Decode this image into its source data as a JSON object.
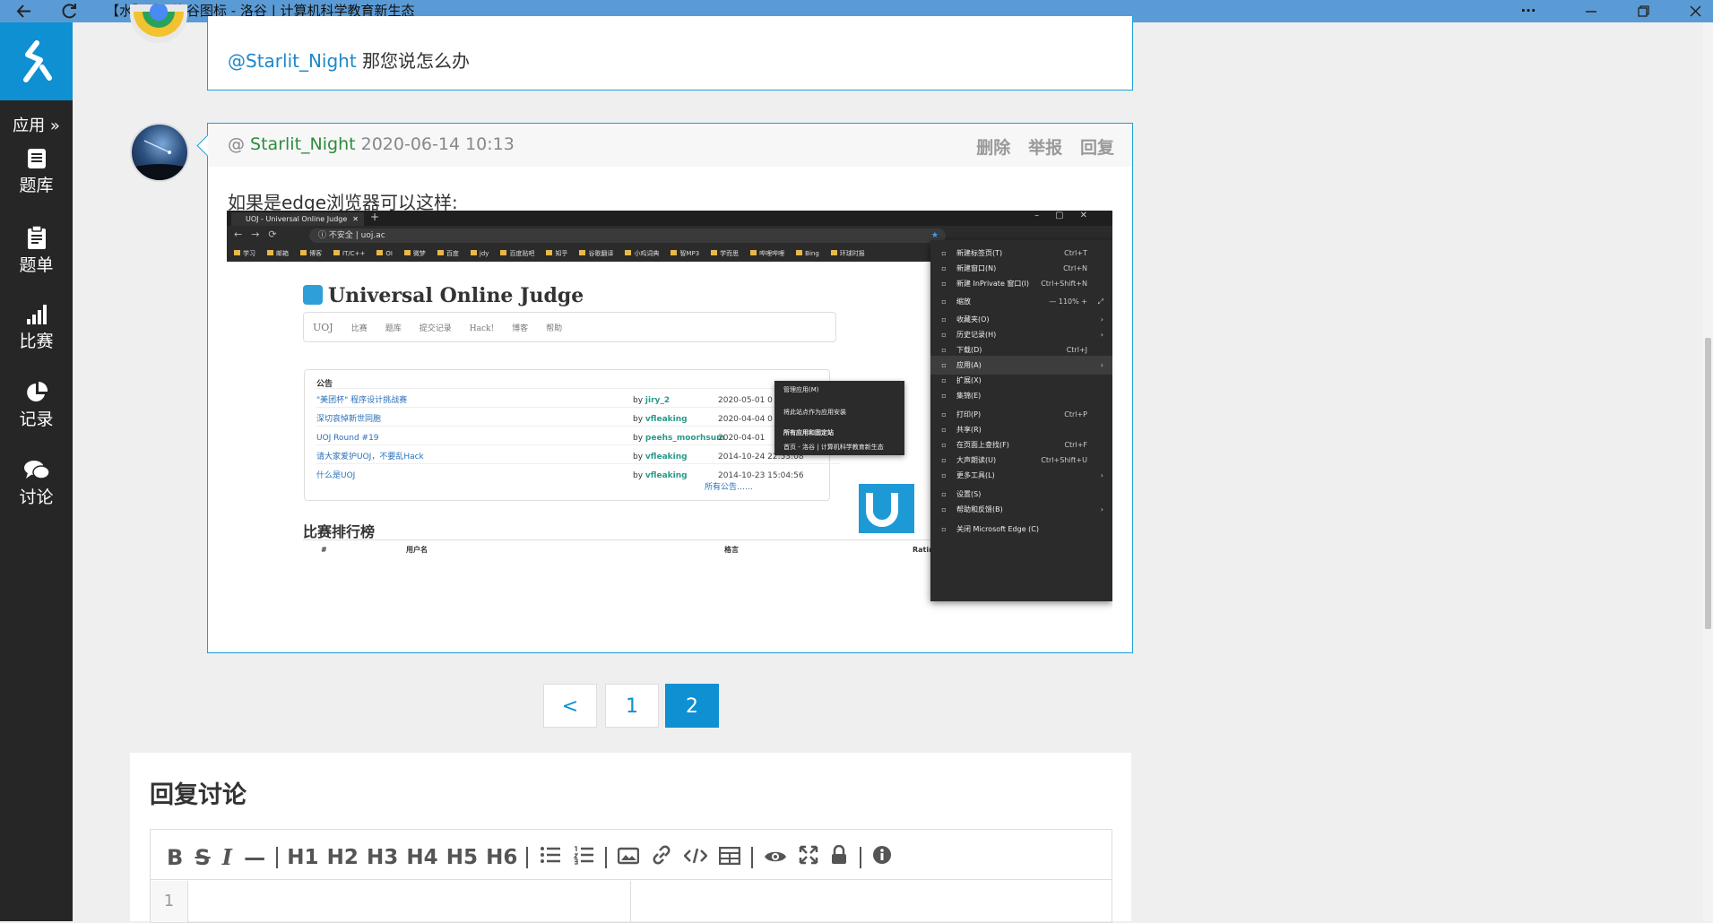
{
  "window": {
    "title": "【水】关于洛谷图标 - 洛谷 | 计算机科学教育新生态",
    "more_label": "···"
  },
  "sidebar": {
    "toggle_label": "应用 »",
    "items": [
      {
        "label": "题库",
        "icon": "book-icon"
      },
      {
        "label": "题单",
        "icon": "clipboard-icon"
      },
      {
        "label": "比赛",
        "icon": "bar-chart-icon"
      },
      {
        "label": "记录",
        "icon": "pie-chart-icon"
      },
      {
        "label": "讨论",
        "icon": "chat-icon"
      }
    ]
  },
  "reply_prev": {
    "mention": "@Starlit_Night",
    "text": "那您说怎么办"
  },
  "reply_main": {
    "at": "@",
    "author": "Starlit_Night",
    "time": "2020-06-14 10:13",
    "actions": {
      "delete": "删除",
      "report": "举报",
      "reply": "回复"
    },
    "text": "如果是edge浏览器可以这样:"
  },
  "embedded_screenshot": {
    "tab_title": "UOJ - Universal Online Judge",
    "address_warning": "不安全",
    "address": "uoj.ac",
    "bookmarks": [
      "学习",
      "邮箱",
      "博客",
      "IT/C++",
      "OI",
      "微梦",
      "百度",
      "jdy",
      "百度贴吧",
      "知乎",
      "谷歌翻译",
      "小鸡词典",
      "智MP3",
      "学而思",
      "哔哩哔哩",
      "Bing",
      "环球时报"
    ],
    "site_title": "Universal Online Judge",
    "site_nav": [
      "UOJ",
      "比赛",
      "题库",
      "提交记录",
      "Hack!",
      "博客",
      "帮助"
    ],
    "announce_heading": "公告",
    "announcements": [
      {
        "title": "\"美团杯\" 程序设计挑战赛",
        "by": "by",
        "author": "jiry_2",
        "date": "2020-05-01 0"
      },
      {
        "title": "深切哀悼新世同胞",
        "by": "by",
        "author": "vfleaking",
        "date": "2020-04-04 0"
      },
      {
        "title": "UOJ Round #19",
        "by": "by",
        "author": "peehs_moorhsum",
        "date": "2020-04-01"
      },
      {
        "title": "请大家爱护UOJ，不要乱Hack",
        "by": "by",
        "author": "vfleaking",
        "date": "2014-10-24 22:53:08"
      },
      {
        "title": "什么是UOJ",
        "by": "by",
        "author": "vfleaking",
        "date": "2014-10-23 15:04:56"
      }
    ],
    "all_announcements": "所有公告……",
    "rank_heading": "比赛排行榜",
    "rank_columns": [
      "#",
      "用户名",
      "格言",
      "Rating"
    ],
    "apps_submenu": [
      "管理应用(M)",
      "将此站点作为应用安装",
      "所有应用和固定站",
      "首页 - 洛谷 | 计算机科学教育新生态"
    ],
    "edge_menu": [
      {
        "label": "新建标签页(T)",
        "shortcut": "Ctrl+T",
        "arrow": ""
      },
      {
        "label": "新建窗口(N)",
        "shortcut": "Ctrl+N",
        "arrow": ""
      },
      {
        "label": "新建 InPrivate 窗口(I)",
        "shortcut": "Ctrl+Shift+N",
        "arrow": ""
      },
      {
        "label": "缩放",
        "shortcut": "—   110%   +",
        "arrow": "⤢"
      },
      {
        "label": "收藏夹(O)",
        "shortcut": "",
        "arrow": "›"
      },
      {
        "label": "历史记录(H)",
        "shortcut": "",
        "arrow": "›"
      },
      {
        "label": "下载(D)",
        "shortcut": "Ctrl+J",
        "arrow": ""
      },
      {
        "label": "应用(A)",
        "shortcut": "",
        "arrow": "›"
      },
      {
        "label": "扩展(X)",
        "shortcut": "",
        "arrow": ""
      },
      {
        "label": "集锦(E)",
        "shortcut": "",
        "arrow": ""
      },
      {
        "label": "打印(P)",
        "shortcut": "Ctrl+P",
        "arrow": ""
      },
      {
        "label": "共享(R)",
        "shortcut": "",
        "arrow": ""
      },
      {
        "label": "在页面上查找(F)",
        "shortcut": "Ctrl+F",
        "arrow": ""
      },
      {
        "label": "大声朗读(U)",
        "shortcut": "Ctrl+Shift+U",
        "arrow": ""
      },
      {
        "label": "更多工具(L)",
        "shortcut": "",
        "arrow": "›"
      },
      {
        "label": "设置(S)",
        "shortcut": "",
        "arrow": ""
      },
      {
        "label": "帮助和反馈(B)",
        "shortcut": "",
        "arrow": "›"
      },
      {
        "label": "关闭 Microsoft Edge (C)",
        "shortcut": "",
        "arrow": ""
      }
    ]
  },
  "pagination": {
    "prev": "<",
    "pages": [
      "1",
      "2"
    ],
    "current": "2"
  },
  "reply_section": {
    "heading": "回复讨论",
    "toolbar": [
      "B",
      "S",
      "I",
      "—",
      "H1",
      "H2",
      "H3",
      "H4",
      "H5",
      "H6"
    ],
    "line_number": "1"
  }
}
